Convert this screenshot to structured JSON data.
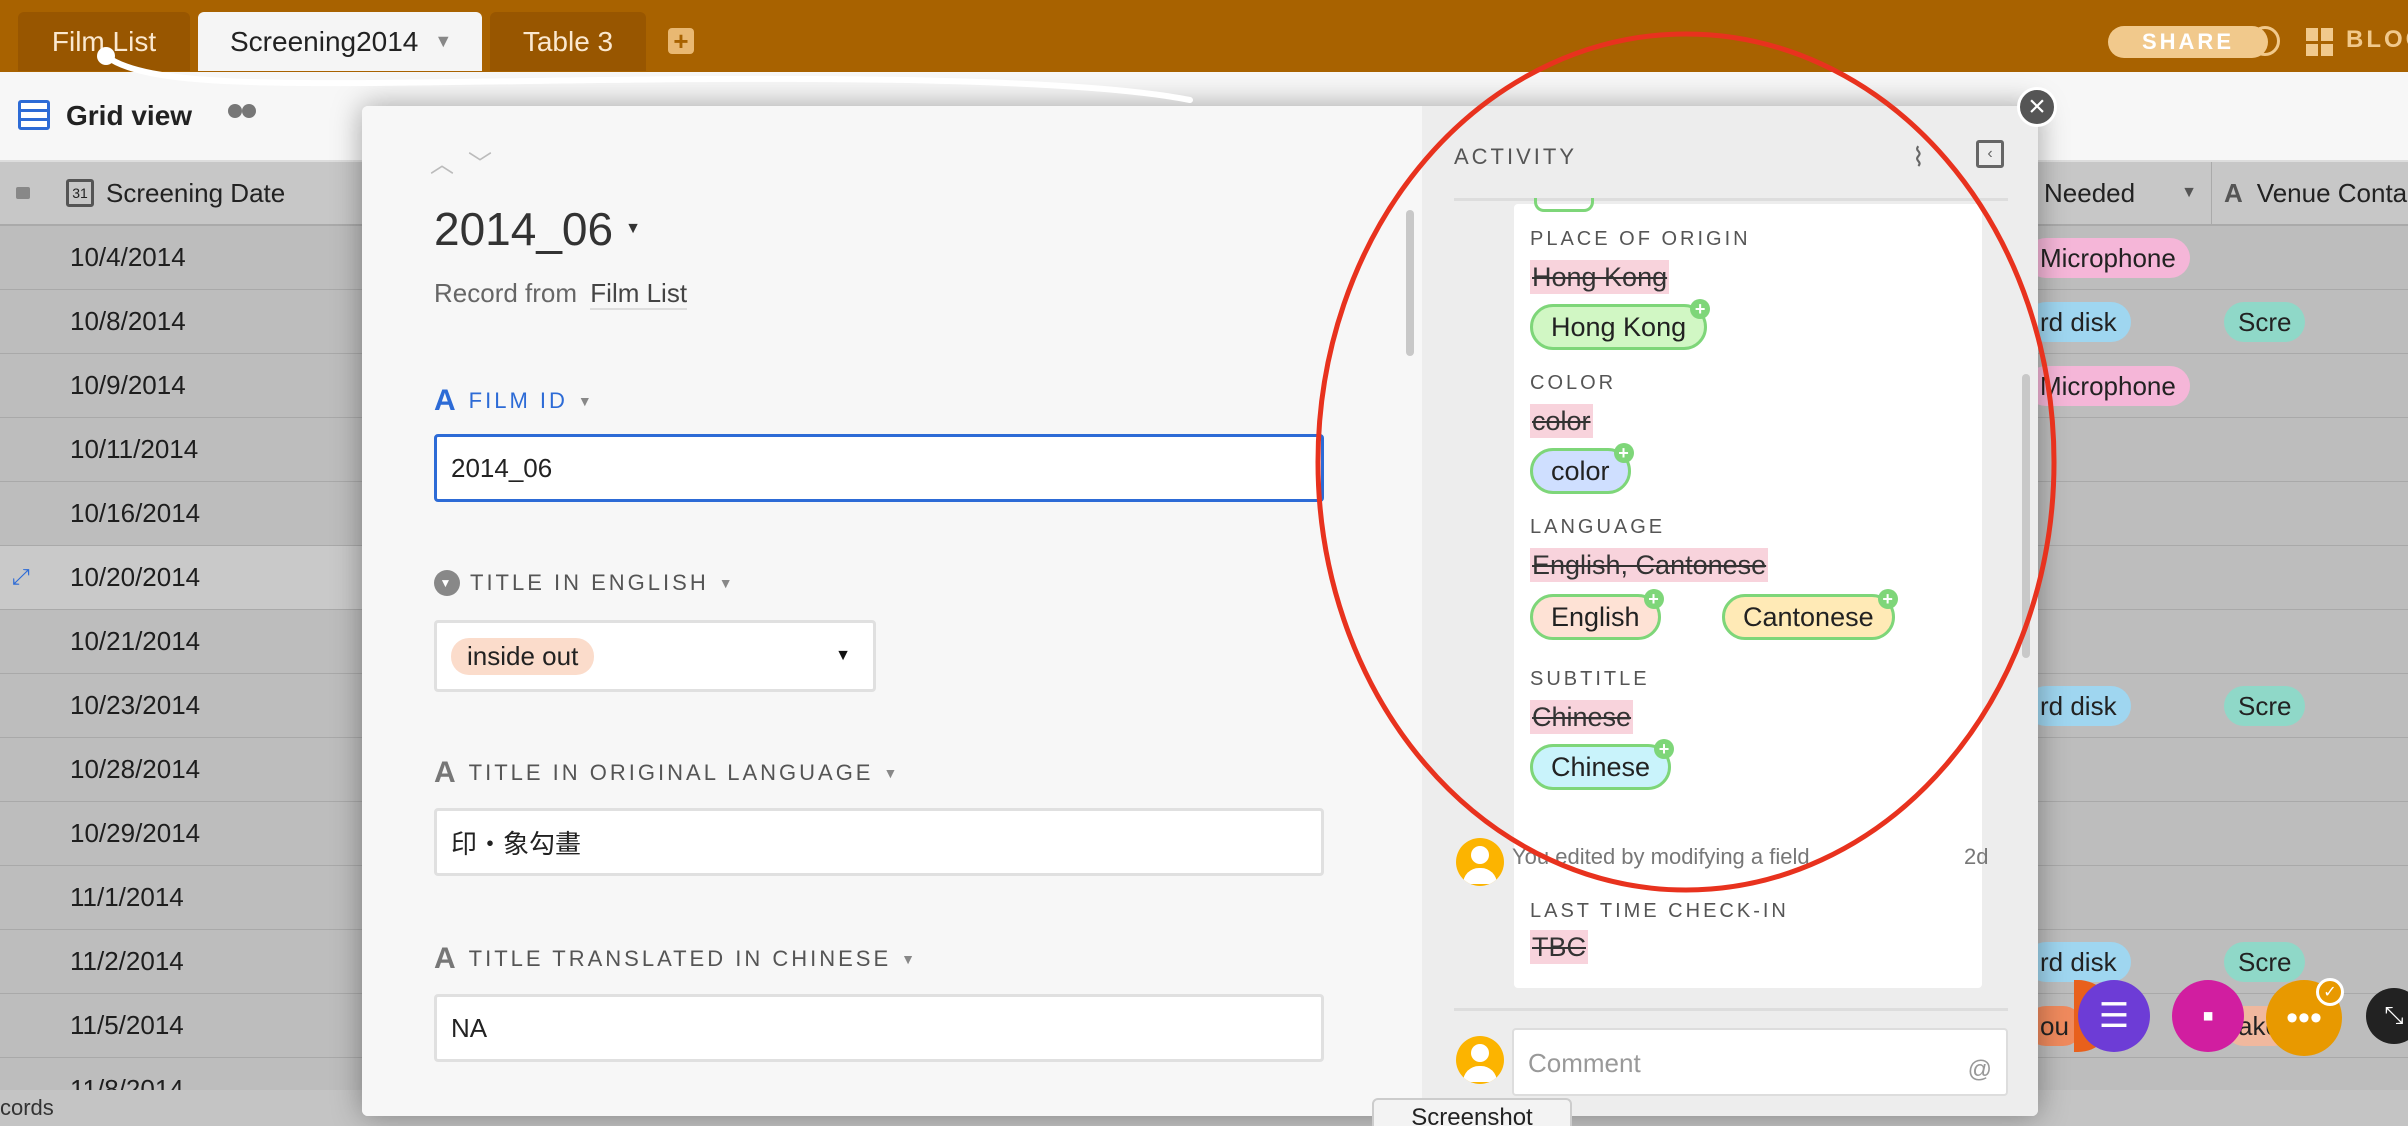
{
  "tabs": [
    {
      "label": "Film List"
    },
    {
      "label": "Screening2014"
    },
    {
      "label": "Table 3"
    }
  ],
  "topbar": {
    "share_label": "SHARE",
    "blocks_label": "BLOC"
  },
  "viewbar": {
    "view_name": "Grid view"
  },
  "grid": {
    "col_screening_date": "Screening Date",
    "col_needed": "Needed",
    "col_venue": "Venue Conta",
    "rows": [
      "10/4/2014",
      "10/8/2014",
      "10/9/2014",
      "10/11/2014",
      "10/16/2014",
      "10/20/2014",
      "10/21/2014",
      "10/23/2014",
      "10/28/2014",
      "10/29/2014",
      "11/1/2014",
      "11/2/2014",
      "11/5/2014",
      "11/8/2014"
    ],
    "right_cells": [
      [
        "Microphone",
        ""
      ],
      [
        "rd disk",
        "Scre"
      ],
      [
        "Microphone",
        ""
      ],
      [
        "",
        ""
      ],
      [
        "",
        ""
      ],
      [
        "",
        ""
      ],
      [
        "",
        ""
      ],
      [
        "rd disk",
        "Scre"
      ],
      [
        "",
        ""
      ],
      [
        "",
        ""
      ],
      [
        "",
        ""
      ],
      [
        "rd disk",
        "Scre"
      ],
      [
        "ou",
        "ake"
      ]
    ],
    "status": "cords"
  },
  "record": {
    "title": "2014_06",
    "subtitle_prefix": "Record from",
    "subtitle_table": "Film List",
    "fields": [
      {
        "label": "FILM ID",
        "value": "2014_06"
      },
      {
        "label": "TITLE IN ENGLISH",
        "value": "inside out"
      },
      {
        "label": "TITLE IN ORIGINAL LANGUAGE",
        "value": "印・象勾畫"
      },
      {
        "label": "TITLE TRANSLATED IN CHINESE",
        "value": "NA"
      }
    ]
  },
  "activity": {
    "header": "ACTIVITY",
    "changes": [
      {
        "field": "PLACE OF ORIGIN",
        "old": "Hong Kong",
        "new": [
          "Hong Kong"
        ]
      },
      {
        "field": "COLOR",
        "old": "color",
        "new": [
          "color"
        ]
      },
      {
        "field": "LANGUAGE",
        "old": "English, Cantonese",
        "new": [
          "English",
          "Cantonese"
        ]
      },
      {
        "field": "SUBTITLE",
        "old": "Chinese",
        "new": [
          "Chinese"
        ]
      }
    ],
    "entry2_text": "You edited by modifying a field",
    "entry2_time": "2d",
    "entry2_field": "LAST TIME CHECK-IN",
    "entry2_old": "TBC",
    "comment_placeholder": "Comment",
    "comment_at": "@"
  },
  "screenshot_label": "Screenshot",
  "colors": {
    "topbar": "#a86200",
    "annotation": "#e8321e",
    "field_blue": "#2d6bd6"
  }
}
